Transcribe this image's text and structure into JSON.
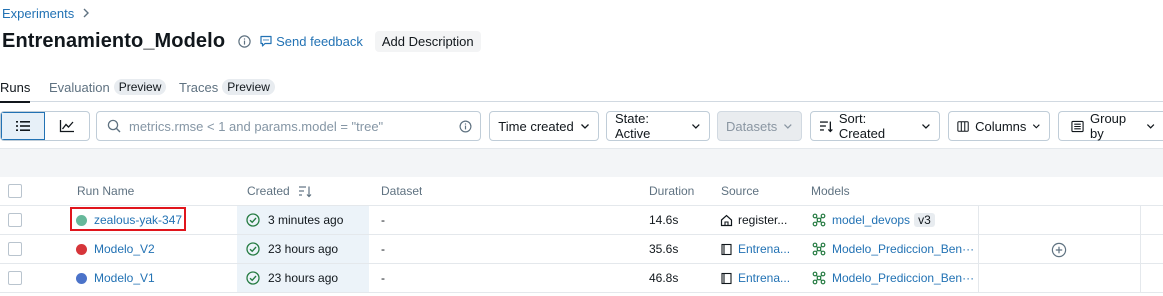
{
  "breadcrumb": {
    "root": "Experiments"
  },
  "header": {
    "title": "Entrenamiento_Modelo",
    "feedback_label": "Send feedback",
    "add_description_label": "Add Description"
  },
  "tabs": [
    {
      "label": "Runs",
      "badge": ""
    },
    {
      "label": "Evaluation",
      "badge": "Preview"
    },
    {
      "label": "Traces",
      "badge": "Preview"
    }
  ],
  "toolbar": {
    "search_placeholder": "metrics.rmse < 1 and params.model = \"tree\"",
    "time_created": "Time created",
    "state": "State: Active",
    "datasets": "Datasets",
    "sort": "Sort: Created",
    "columns": "Columns",
    "group_by": "Group by"
  },
  "table": {
    "headers": {
      "run_name": "Run Name",
      "created": "Created",
      "dataset": "Dataset",
      "duration": "Duration",
      "source": "Source",
      "models": "Models"
    },
    "rows": [
      {
        "run_name": "zealous-yak-347",
        "dot_color": "#66b89a",
        "created": "3 minutes ago",
        "dataset": "-",
        "duration": "14.6s",
        "source": "register...",
        "source_icon": "notebook-icon",
        "model": "model_devops",
        "version": "v3"
      },
      {
        "run_name": "Modelo_V2",
        "dot_color": "#d6353a",
        "created": "23 hours ago",
        "dataset": "-",
        "duration": "35.6s",
        "source": "Entrena...",
        "source_icon": "file-icon",
        "model": "Modelo_Prediccion_Ben···",
        "version": ""
      },
      {
        "run_name": "Modelo_V1",
        "dot_color": "#4b73c9",
        "created": "23 hours ago",
        "dataset": "-",
        "duration": "46.8s",
        "source": "Entrena...",
        "source_icon": "file-icon",
        "model": "Modelo_Prediccion_Ben···",
        "version": ""
      }
    ]
  },
  "colors": {
    "link": "#2272b4",
    "highlight": "#e0151c",
    "success": "#277c43"
  }
}
